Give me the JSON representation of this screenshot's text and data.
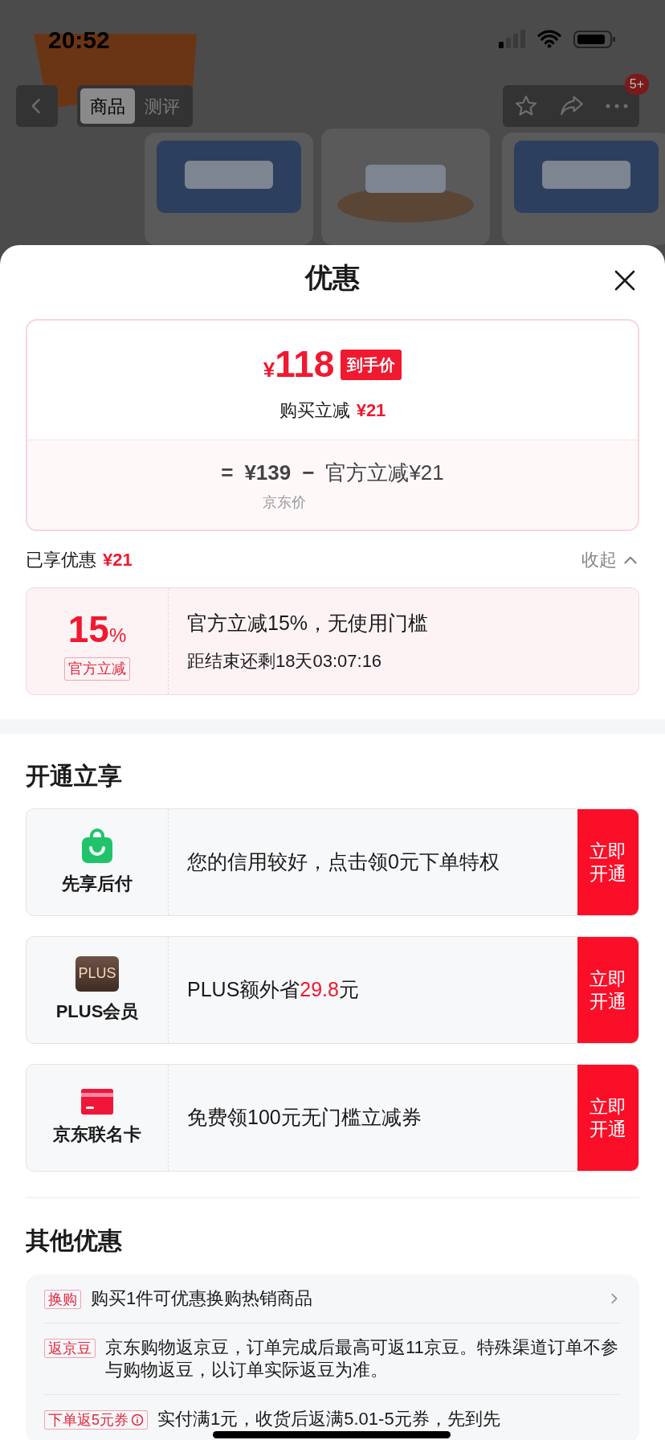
{
  "status_bar": {
    "time": "20:52"
  },
  "nav": {
    "tabs": [
      {
        "label": "商品",
        "selected": true
      },
      {
        "label": "测评",
        "selected": false
      }
    ],
    "badge": "5+"
  },
  "sheet": {
    "title": "优惠",
    "price": {
      "currency": "¥",
      "amount": "118",
      "tag": "到手价",
      "saving_label": "购买立减",
      "saving": "¥21",
      "equals": "=",
      "base_price": "¥139",
      "minus": "−",
      "deduction": "官方立减¥21",
      "base_label": "京东价"
    },
    "enjoyed": {
      "label": "已享优惠",
      "amount": "¥21",
      "toggle": "收起",
      "expanded": true
    },
    "coupon": {
      "value": "15",
      "unit": "%",
      "tag": "官方立减",
      "title": "官方立减15%，无使用门槛",
      "countdown": "距结束还剩18天03:07:16"
    },
    "services_title": "开通立享",
    "services": [
      {
        "kind": "bag",
        "name": "先享后付",
        "text": "您的信用较好，点击领0元下单特权",
        "button": "立即开通"
      },
      {
        "kind": "plus",
        "icon_text": "PLUS",
        "name": "PLUS会员",
        "text": "PLUS额外省",
        "highlight": "29.8",
        "text_after": "元",
        "button": "立即开通"
      },
      {
        "kind": "card",
        "name": "京东联名卡",
        "text": "免费领100元无门槛立减券",
        "button": "立即开通"
      }
    ],
    "other_title": "其他优惠",
    "offers": [
      {
        "tag": "换购",
        "text": "购买1件可优惠换购热销商品",
        "has_arrow": true,
        "info": false
      },
      {
        "tag": "返京豆",
        "text": "京东购物返京豆，订单完成后最高可返11京豆。特殊渠道订单不参与购物返豆，以订单实际返豆为准。",
        "has_arrow": false,
        "info": false
      },
      {
        "tag": "下单返5元券",
        "text": "实付满1元，收货后返满5.01-5元券，先到先",
        "has_arrow": false,
        "info": true
      }
    ]
  }
}
